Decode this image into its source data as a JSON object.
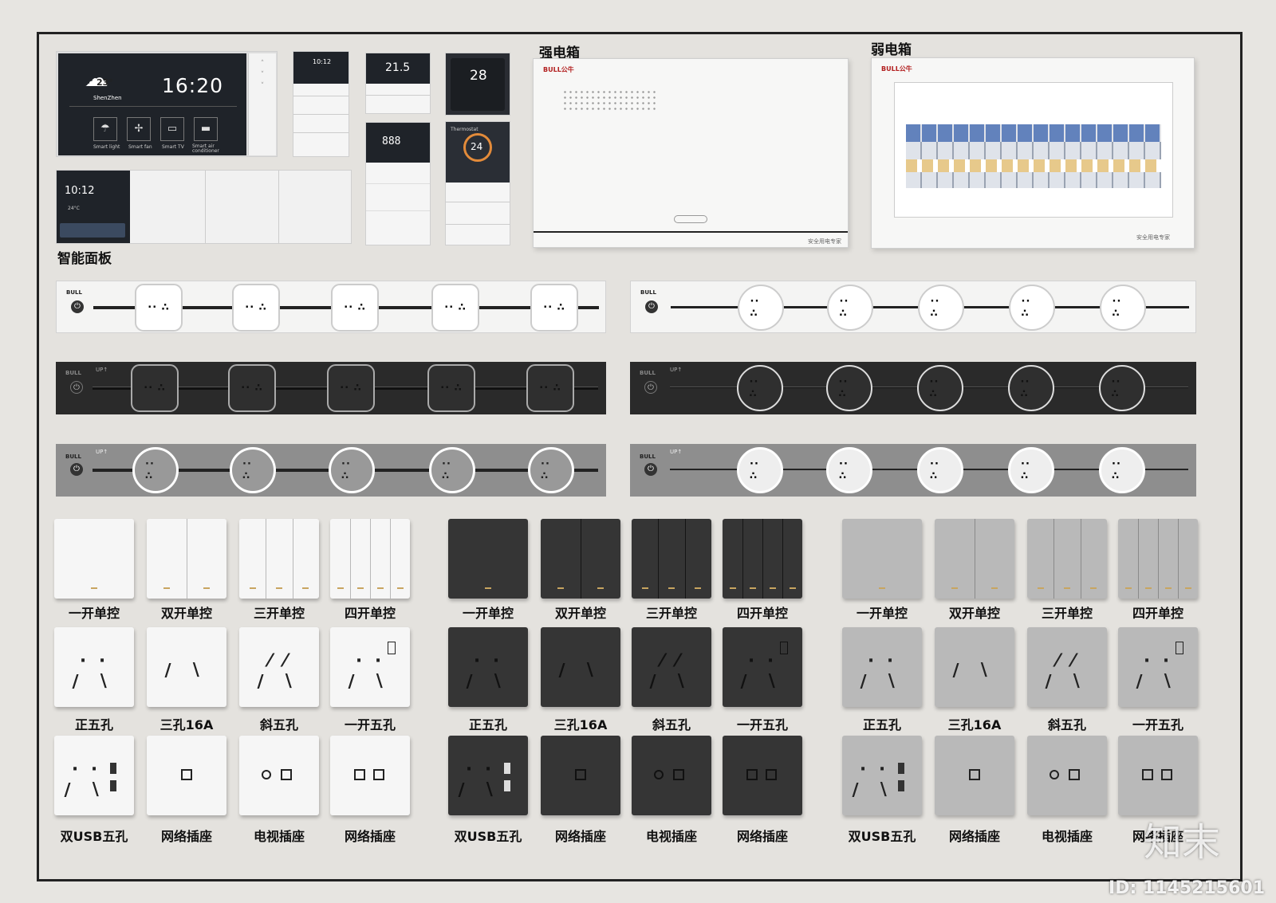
{
  "smart": {
    "section_label": "智能面板",
    "main": {
      "temp": "23°",
      "city": "ShenZhen",
      "time": "16:20",
      "tiles": [
        "Smart light",
        "Smart fan",
        "Smart TV",
        "Smart air conditioner"
      ]
    },
    "small": {
      "time": "10:12"
    },
    "thermo1": {
      "value": "21.5"
    },
    "thermo2": {
      "value": "28"
    },
    "thermo3": {
      "label": "Thermostat",
      "value": "24"
    },
    "wide": {
      "time": "10:12",
      "temp": "24°C"
    }
  },
  "strong_box": {
    "title": "强电箱",
    "brand": "BULL公牛",
    "footer": "安全用电专家"
  },
  "weak_box": {
    "title": "弱电箱",
    "brand": "BULL公牛",
    "footer": "安全用电专家"
  },
  "strips": {
    "brand": "BULL",
    "up": "UP↑"
  },
  "icons": {
    "power": "power-icon"
  },
  "colors": {
    "white": "#f6f6f6",
    "black": "#353535",
    "gray": "#b9b9b9",
    "accent": "#c8a560"
  },
  "switch_labels": [
    "一开单控",
    "双开单控",
    "三开单控",
    "四开单控"
  ],
  "socket_labels": [
    "正五孔",
    "三孔16A",
    "斜五孔",
    "一开五孔"
  ],
  "data_labels": [
    "双USB五孔",
    "网络插座",
    "电视插座",
    "网络插座"
  ],
  "watermark": {
    "logo": "知末",
    "id": "ID: 1145215601"
  }
}
